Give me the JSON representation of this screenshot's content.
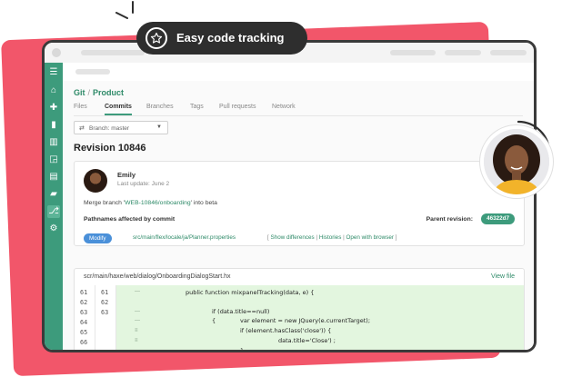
{
  "badge": {
    "label": "Easy code tracking",
    "icon": "star-icon"
  },
  "breadcrumb": {
    "repo_type": "Git",
    "separator": "/",
    "project": "Product"
  },
  "tabs": [
    {
      "label": "Files",
      "active": false
    },
    {
      "label": "Commits",
      "active": true
    },
    {
      "label": "Branches",
      "active": false
    },
    {
      "label": "Tags",
      "active": false
    },
    {
      "label": "Pull requests",
      "active": false
    },
    {
      "label": "Network",
      "active": false
    }
  ],
  "branch_select": {
    "label": "Branch: master"
  },
  "revision": {
    "title": "Revision 10846"
  },
  "commit": {
    "author": "Emily",
    "last_update": "Last update:  June 2",
    "message_pre": "Merge branch '",
    "message_link": "WEB-10846/onboarding",
    "message_post": "' into beta",
    "paths_label": "Pathnames affected by commit",
    "parent_label": "Parent revision:",
    "parent_hash": "46322d7",
    "modify_label": "Modify",
    "file_path": "src/main/flex/locale/ja/Planner.properties",
    "actions": {
      "open": "[",
      "show_differences": "Show differences",
      "sep": "|",
      "histories": "Histories",
      "open_with_browser": "Open with browser",
      "close": "]"
    }
  },
  "file": {
    "name": "scr/main/haxe/web/dialog/OnboardingDialogStart.hx",
    "view_label": "View file",
    "old_lines": [
      "61",
      "62",
      "63",
      "64",
      "65",
      "66"
    ],
    "new_lines": [
      "61",
      "62",
      "63"
    ],
    "code": [
      "public function mixpanelTracking(data, e) {",
      "if (data.title==null)",
      "{",
      "var element = new JQuery(e.currentTarget);",
      "if (element.hasClass('close')) {",
      "data.title='Close') ;",
      "}"
    ]
  },
  "colors": {
    "accent": "#3d9b7c",
    "pink": "#f2566a",
    "dark": "#2e2e2e",
    "button_blue": "#4a90d9",
    "code_bg": "#e3f6df"
  }
}
